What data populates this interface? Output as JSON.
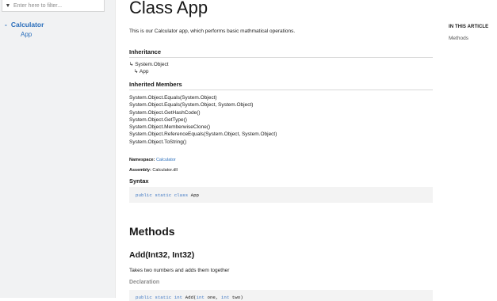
{
  "sidebar": {
    "filter_placeholder": "Enter here to filter...",
    "namespace": "Calculator",
    "namespace_prefix": "-",
    "class_item": "App"
  },
  "main": {
    "title": "Class App",
    "summary": "This is our Calculator app, which performs basic mathmatical operations.",
    "inheritance_heading": "Inheritance",
    "inheritance": [
      "↳ System.Object",
      "↳ App"
    ],
    "inherited_members_heading": "Inherited Members",
    "inherited_members": [
      "System.Object.Equals(System.Object)",
      "System.Object.Equals(System.Object, System.Object)",
      "System.Object.GetHashCode()",
      "System.Object.GetType()",
      "System.Object.MemberwiseClone()",
      "System.Object.ReferenceEquals(System.Object, System.Object)",
      "System.Object.ToString()"
    ],
    "namespace_label": "Namespace",
    "namespace_value": "Calculator",
    "assembly_label": "Assembly",
    "assembly_value": "Calculator.dll",
    "syntax_heading": "Syntax",
    "syntax_keywords": "public static class",
    "syntax_name": "App",
    "methods_heading": "Methods",
    "method_title": "Add(Int32, Int32)",
    "method_summary": "Takes two numbers and adds them together",
    "declaration_heading": "Declaration",
    "declaration_kw1": "public static int",
    "declaration_mid": "Add(",
    "declaration_kw2": "int",
    "declaration_arg1": "one,",
    "declaration_kw3": "int",
    "declaration_arg2": "two)"
  },
  "aside": {
    "heading": "IN THIS ARTICLE",
    "link": "Methods"
  }
}
